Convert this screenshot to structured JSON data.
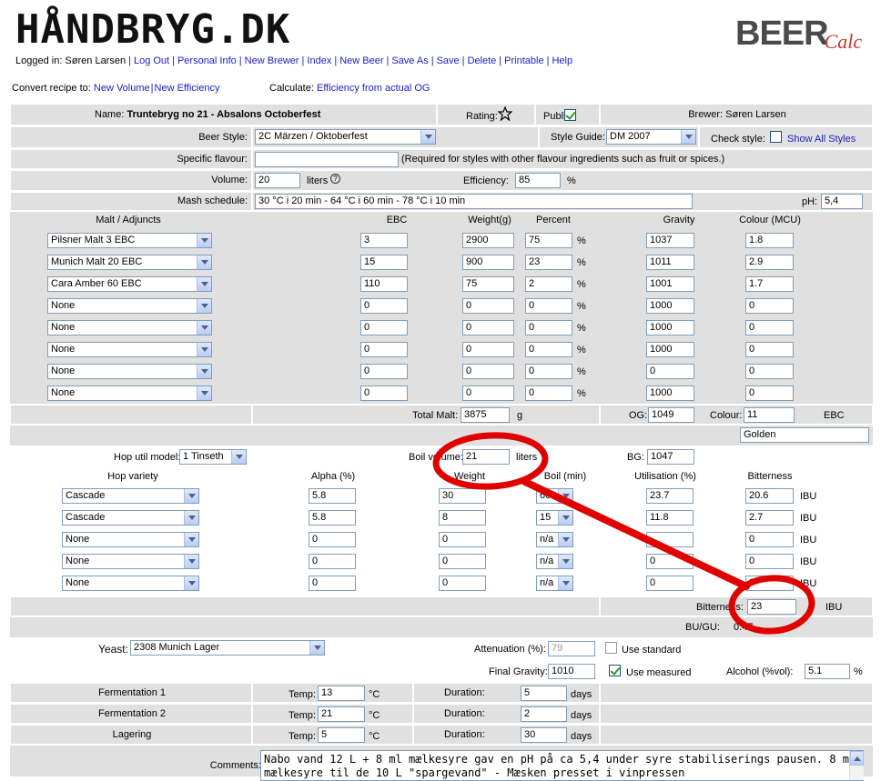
{
  "site": {
    "logo": "HÅNDBRYG.DK",
    "brand_main": "BEER",
    "brand_sub": "Calc"
  },
  "nav": {
    "logged_in": "Logged in: Søren Larsen",
    "links": [
      "Log Out",
      "Personal Info",
      "New Brewer",
      "Index",
      "New Beer",
      "Save As",
      "Save",
      "Delete",
      "Printable",
      "Help"
    ]
  },
  "convert": {
    "label": "Convert recipe to:",
    "new_volume": "New Volume",
    "new_efficiency": "New Efficiency",
    "calc_label": "Calculate:",
    "efficiency_og": "Efficiency from actual OG"
  },
  "header": {
    "name_label": "Name:",
    "name_value": "Truntebryg no 21 - Absalons Octoberfest",
    "rating_label": "Rating:",
    "public_label": "Public:",
    "brewer": "Brewer: Søren Larsen"
  },
  "style": {
    "beer_style_label": "Beer Style:",
    "beer_style_value": "2C  Märzen / Oktoberfest",
    "style_guide_label": "Style Guide:",
    "style_guide_value": "DM 2007",
    "check_style_label": "Check style:",
    "show_all": "Show All Styles"
  },
  "flavour": {
    "label": "Specific flavour:",
    "value": "",
    "note": "(Required for styles with other flavour ingredients such as fruit or spices.)"
  },
  "volume": {
    "label": "Volume:",
    "value": "20",
    "unit": "liters",
    "help": "?",
    "efficiency_label": "Efficiency:",
    "efficiency_value": "85",
    "efficiency_unit": "%"
  },
  "mash": {
    "label": "Mash schedule:",
    "value": "30 °C i 20 min - 64 °C i 60 min - 78 °C i 10 min",
    "ph_label": "pH:",
    "ph_value": "5,4"
  },
  "malt": {
    "headers": [
      "Malt / Adjuncts",
      "EBC",
      "Weight(g)",
      "Percent",
      "Gravity",
      "Colour (MCU)"
    ],
    "percent_unit": "%",
    "rows": [
      {
        "name": "Pilsner Malt 3 EBC",
        "ebc": "3",
        "weight": "2900",
        "percent": "75",
        "gravity": "1037",
        "colour": "1.8"
      },
      {
        "name": "Munich Malt 20 EBC",
        "ebc": "15",
        "weight": "900",
        "percent": "23",
        "gravity": "1011",
        "colour": "2.9"
      },
      {
        "name": "Cara Amber 60 EBC",
        "ebc": "110",
        "weight": "75",
        "percent": "2",
        "gravity": "1001",
        "colour": "1.7"
      },
      {
        "name": "None",
        "ebc": "0",
        "weight": "0",
        "percent": "0",
        "gravity": "1000",
        "colour": "0"
      },
      {
        "name": "None",
        "ebc": "0",
        "weight": "0",
        "percent": "0",
        "gravity": "1000",
        "colour": "0"
      },
      {
        "name": "None",
        "ebc": "0",
        "weight": "0",
        "percent": "0",
        "gravity": "1000",
        "colour": "0"
      },
      {
        "name": "None",
        "ebc": "0",
        "weight": "0",
        "percent": "0",
        "gravity": "0",
        "colour": "0"
      },
      {
        "name": "None",
        "ebc": "0",
        "weight": "0",
        "percent": "0",
        "gravity": "1000",
        "colour": "0"
      }
    ],
    "total_label": "Total Malt:",
    "total_value": "3875",
    "total_unit": "g",
    "og_label": "OG:",
    "og_value": "1049",
    "colour_label": "Colour:",
    "colour_value": "11",
    "colour_unit": "EBC",
    "colour_name": "Golden"
  },
  "hops": {
    "util_label": "Hop util model:",
    "util_value": "1  Tinseth",
    "boil_label": "Boil volume:",
    "boil_value": "21",
    "boil_unit": "liters",
    "bg_label": "BG:",
    "bg_value": "1047",
    "headers": [
      "Hop variety",
      "Alpha (%)",
      "Weight",
      "Boil (min)",
      "Utilisation (%)",
      "Bitterness"
    ],
    "ibu_unit": "IBU",
    "rows": [
      {
        "name": "Cascade",
        "alpha": "5.8",
        "weight": "30",
        "boil": "60",
        "util": "23.7",
        "bitterness": "20.6"
      },
      {
        "name": "Cascade",
        "alpha": "5.8",
        "weight": "8",
        "boil": "15",
        "util": "11.8",
        "bitterness": "2.7"
      },
      {
        "name": "None",
        "alpha": "0",
        "weight": "0",
        "boil": "n/a",
        "util": "",
        "bitterness": "0"
      },
      {
        "name": "None",
        "alpha": "0",
        "weight": "0",
        "boil": "n/a",
        "util": "0",
        "bitterness": "0"
      },
      {
        "name": "None",
        "alpha": "0",
        "weight": "0",
        "boil": "n/a",
        "util": "0",
        "bitterness": "0"
      }
    ],
    "bitterness_label": "Bitterness:",
    "bitterness_value": "23",
    "bugu_label": "BU/GU:",
    "bugu_value": "0.47"
  },
  "yeast": {
    "label": "Yeast:",
    "value": "2308 Munich Lager",
    "attenuation_label": "Attenuation (%):",
    "attenuation_value": "79",
    "use_standard": "Use standard",
    "fg_label": "Final Gravity:",
    "fg_value": "1010",
    "use_measured": "Use measured",
    "alcohol_label": "Alcohol (%vol):",
    "alcohol_value": "5.1",
    "alcohol_unit": "%"
  },
  "fermentation": {
    "temp_label": "Temp:",
    "temp_unit": "°C",
    "duration_label": "Duration:",
    "duration_unit": "days",
    "rows": [
      {
        "name": "Fermentation 1",
        "temp": "13",
        "duration": "5"
      },
      {
        "name": "Fermentation 2",
        "temp": "21",
        "duration": "2"
      },
      {
        "name": "Lagering",
        "temp": "5",
        "duration": "30"
      }
    ]
  },
  "comments": {
    "label": "Comments:",
    "value": "Nabo vand 12 L + 8 ml mælkesyre gav en pH på ca 5,4 under syre stabiliserings pausen. 8 ml mælkesyre til de 10 L \"spargevand\" - Mæsken presset i vinpressen"
  },
  "colors": {
    "panel": "#e0e0e0",
    "link": "#1c1cc8",
    "annotation": "#e00000"
  }
}
